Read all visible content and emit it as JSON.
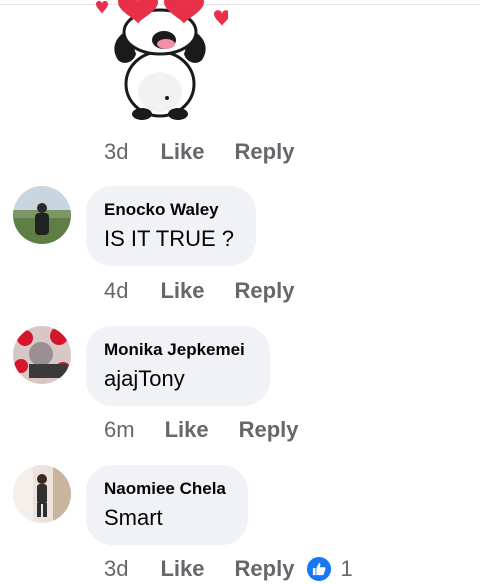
{
  "colors": {
    "bubble_bg": "#f0f2f5",
    "meta_text": "#65676b",
    "like_blue": "#1877f2"
  },
  "sticker": {
    "icon": "panda-heart-eyes-sticker"
  },
  "comments_meta": {
    "sticker_comment": {
      "time": "3d",
      "like": "Like",
      "reply": "Reply"
    }
  },
  "comments": [
    {
      "name": "Enocko Waley",
      "text": "IS IT TRUE ?",
      "time": "4d",
      "like": "Like",
      "reply": "Reply"
    },
    {
      "name": "Monika Jepkemei",
      "text": "ajajTony",
      "time": "6m",
      "like": "Like",
      "reply": "Reply"
    },
    {
      "name": "Naomiee Chela",
      "text": "Smart",
      "time": "3d",
      "like": "Like",
      "reply": "Reply",
      "reaction_icon": "thumbs-up-icon",
      "reaction_count": "1"
    }
  ]
}
